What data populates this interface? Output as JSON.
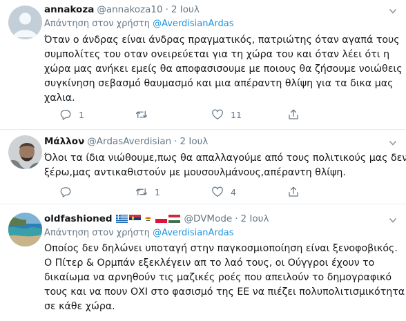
{
  "tweets": [
    {
      "name": "annakoza",
      "handle": "@annakoza10",
      "sep": "·",
      "time": "2 Ιουλ",
      "reply_prefix": "Απάντηση στον χρήστη",
      "reply_mention": "@AverdisianArdas",
      "lines": [
        "Όταν ο άνδρας είναι άνδρας πραγματικός, πατριώτης όταν αγαπά τους",
        "συμπολίτες του οταν ονειρεύεται για τη χώρα του και όταν λέει ότι η",
        "χώρα μας ανήκει εμείς θα αποφασισουμε με ποιους  θα ζήσουμε νοιώθεις",
        "συγκίνηση σεβασμό θαυμασμό και μια απέραντη θλίψη για τα δικα μας",
        "χαλια."
      ],
      "counts": {
        "reply": "1",
        "retweet": "",
        "like": "11"
      }
    },
    {
      "name": "Μάλλον",
      "handle": "@ArdasAverdisian",
      "sep": "·",
      "time": "2 Ιουλ",
      "lines": [
        "Όλοι τα ίδια νιώθουμε,πως θα απαλλαγούμε από τους πολιτικούς μας δεν",
        "ξέρω,μας αντικαθιστούν με μουσουλμάνους,απέραντη θλίψη."
      ],
      "counts": {
        "reply": "",
        "retweet": "1",
        "like": "4"
      }
    },
    {
      "name": "oldfashioned",
      "flags": [
        "greece",
        "serbia",
        "cyprus",
        "poland",
        "hungary"
      ],
      "handle": "@DVMode",
      "sep": "·",
      "time": "2 Ιουλ",
      "reply_prefix": "Απάντηση στον χρήστη",
      "reply_mention": "@AverdisianArdas",
      "lines": [
        "Οποίος δεν δηλώνει υποταγή στην παγκοσμιοποίηση είναι ξενοφοβικός.",
        "Ο Πίτερ & Ορμπάν εξεκλέγειν απ το λαό τους, οι Ούγγροι έχουν το",
        "δικαίωμα να αρνηθούν τις μαζικές ροές που απειλούν το δημογραφικό",
        "τους και να πουν ΟΧΙ στο φασισμό της ΕΕ να πιέζει πολυπολιτισμικότητα",
        "σε κάθε χώρα."
      ]
    }
  ],
  "icons": [
    "chevron-down-icon",
    "reply-icon",
    "retweet-icon",
    "like-icon",
    "share-icon"
  ],
  "colors": {
    "text": "#14171a",
    "muted": "#657786",
    "link": "#1b95e0",
    "divider": "#e6ecf0"
  }
}
